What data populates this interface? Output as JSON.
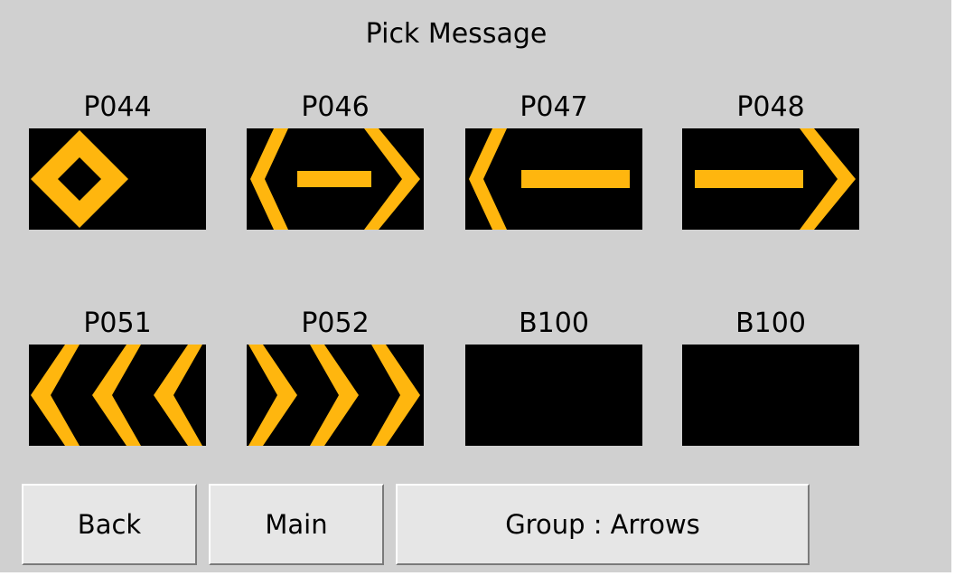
{
  "screen": {
    "title": "Pick Message"
  },
  "messages": [
    {
      "code": "P044",
      "graphic": "diamond-icon"
    },
    {
      "code": "P046",
      "graphic": "double-arrow-icon"
    },
    {
      "code": "P047",
      "graphic": "left-arrow-icon"
    },
    {
      "code": "P048",
      "graphic": "right-arrow-icon"
    },
    {
      "code": "P051",
      "graphic": "triple-chevron-left-icon"
    },
    {
      "code": "P052",
      "graphic": "triple-chevron-right-icon"
    },
    {
      "code": "B100",
      "graphic": "blank"
    },
    {
      "code": "B100",
      "graphic": "blank"
    }
  ],
  "buttons": {
    "back": "Back",
    "main": "Main",
    "group": "Group : Arrows"
  },
  "colors": {
    "background": "#d0d0d0",
    "sign_background": "#000000",
    "sign_amber": "#ffb60e",
    "button_face": "#e6e6e6"
  }
}
